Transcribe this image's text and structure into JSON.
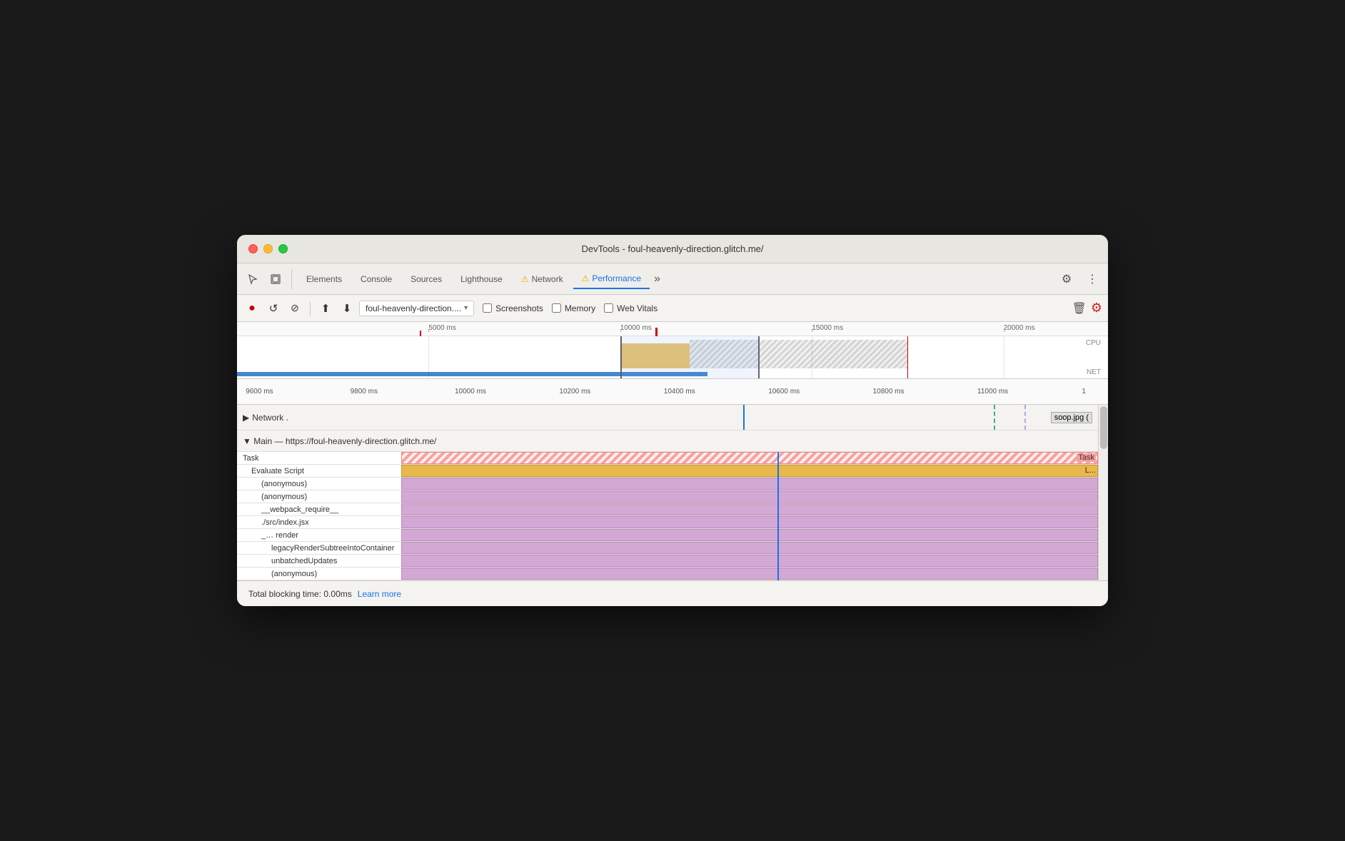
{
  "window": {
    "title": "DevTools - foul-heavenly-direction.glitch.me/"
  },
  "tabs": [
    {
      "label": "Elements",
      "active": false
    },
    {
      "label": "Console",
      "active": false
    },
    {
      "label": "Sources",
      "active": false
    },
    {
      "label": "Lighthouse",
      "active": false
    },
    {
      "label": "Network",
      "active": false,
      "warn": true
    },
    {
      "label": "Performance",
      "active": true,
      "warn": true
    }
  ],
  "toolbar": {
    "record_label": "●",
    "refresh_label": "↺",
    "clear_label": "🚫",
    "upload_label": "↑",
    "download_label": "↓",
    "url_value": "foul-heavenly-direction....",
    "screenshots_label": "Screenshots",
    "memory_label": "Memory",
    "webvitals_label": "Web Vitals"
  },
  "ruler": {
    "ticks": [
      "5000 ms",
      "10000 ms",
      "15000 ms",
      "20000 ms"
    ],
    "cpu_label": "CPU",
    "net_label": "NET"
  },
  "track_ruler": {
    "ticks": [
      "9600 ms",
      "9800 ms",
      "10000 ms",
      "10200 ms",
      "10400 ms",
      "10600 ms",
      "10800 ms",
      "11000 ms",
      "1"
    ]
  },
  "network_row": {
    "label": "Network .",
    "soop": "soop.jpg ("
  },
  "main_thread": {
    "header": "▼ Main — https://foul-heavenly-direction.glitch.me/",
    "rows": [
      {
        "label": "Task",
        "indent": 0,
        "type": "task",
        "right_label": "Task"
      },
      {
        "label": "Evaluate Script",
        "indent": 1,
        "type": "eval",
        "right_label": "L..."
      },
      {
        "label": "(anonymous)",
        "indent": 2,
        "type": "purple"
      },
      {
        "label": "(anonymous)",
        "indent": 2,
        "type": "purple"
      },
      {
        "label": "__webpack_require__",
        "indent": 2,
        "type": "purple"
      },
      {
        "label": "./src/index.jsx",
        "indent": 2,
        "type": "purple"
      },
      {
        "label": "_...  render",
        "indent": 2,
        "type": "purple"
      },
      {
        "label": "legacyRenderSubtreeIntoContainer",
        "indent": 3,
        "type": "purple"
      },
      {
        "label": "unbatchedUpdates",
        "indent": 3,
        "type": "purple"
      },
      {
        "label": "(anonymous)",
        "indent": 3,
        "type": "purple"
      }
    ]
  },
  "status_bar": {
    "total_blocking_time": "Total blocking time: 0.00ms",
    "learn_more": "Learn more"
  },
  "icons": {
    "cursor": "⬖",
    "layers": "⧉",
    "record": "●",
    "refresh": "↺",
    "clear": "⊘",
    "upload": "⬆",
    "download": "⬇",
    "gear": "⚙",
    "kebab": "⋮",
    "trash": "🗑",
    "settings_red": "⚙",
    "triangle_right": "▶",
    "triangle_down": "▼"
  }
}
